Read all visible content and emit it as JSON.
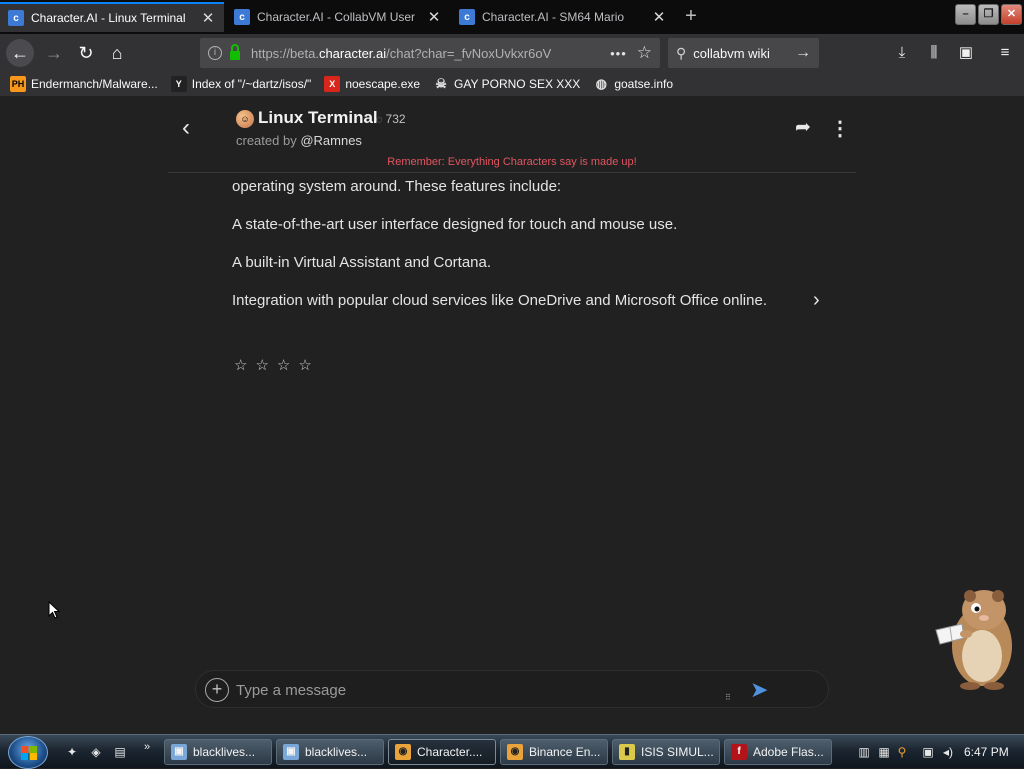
{
  "browser": {
    "tabs": [
      {
        "title": "Character.AI - Linux Terminal",
        "active": true
      },
      {
        "title": "Character.AI - CollabVM User",
        "active": false
      },
      {
        "title": "Character.AI - SM64 Mario",
        "active": false
      }
    ],
    "url_prefix": "https://beta.",
    "url_domain": "character.ai",
    "url_rest": "/chat?char=_fvNoxUvkxr6oV",
    "search_value": "collabvm wiki",
    "bookmarks": [
      {
        "label": "Endermanch/Malware...",
        "icon": "PH"
      },
      {
        "label": "Index of \"/~dartz/isos/\"",
        "icon": "Y"
      },
      {
        "label": "noescape.exe",
        "icon": "X"
      },
      {
        "label": "GAY PORNO SEX XXX",
        "icon": "ghost"
      },
      {
        "label": "goatse.info",
        "icon": "globe"
      }
    ]
  },
  "chat": {
    "character_name": "Linux Terminal",
    "chat_count": "732",
    "created_by_prefix": "created by ",
    "creator": "@Ramnes",
    "reminder": "Remember: Everything Characters say is made up!",
    "messages": [
      "operating system around. These features include:",
      "A state-of-the-art user interface designed for touch and mouse use.",
      "A built-in Virtual Assistant and Cortana.",
      "Integration with popular cloud services like OneDrive and Microsoft Office online."
    ],
    "rating_stars": 4,
    "input_placeholder": "Type a message"
  },
  "taskbar": {
    "tasks": [
      {
        "label": "blacklives...",
        "active": false
      },
      {
        "label": "blacklives...",
        "active": false
      },
      {
        "label": "Character....",
        "active": true
      },
      {
        "label": "Binance En...",
        "active": false
      },
      {
        "label": "ISIS SIMUL...",
        "active": false
      },
      {
        "label": "Adobe Flas...",
        "active": false
      }
    ],
    "clock": "6:47 PM"
  },
  "colors": {
    "accent": "#0a84ff",
    "reminder": "#e25561",
    "send": "#4f93e0",
    "page_bg": "#212121"
  }
}
